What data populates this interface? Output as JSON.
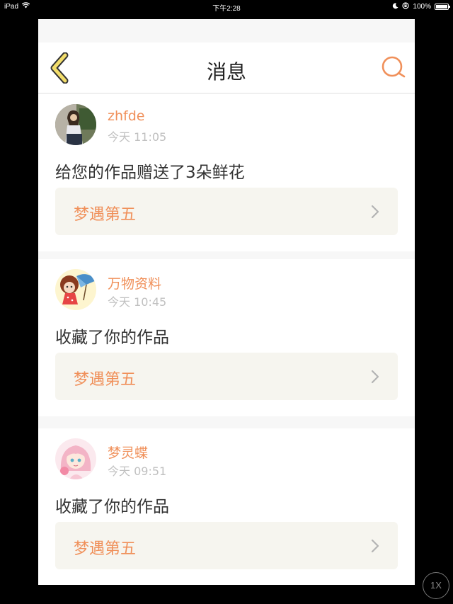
{
  "status_bar": {
    "device": "iPad",
    "time": "下午2:28",
    "battery": "100%",
    "battery_level": 1.0
  },
  "header": {
    "title": "消息",
    "back_icon": "chevron-left-icon",
    "search_icon": "search-icon"
  },
  "messages": [
    {
      "username": "zhfde",
      "time": "今天 11:05",
      "text": "给您的作品赠送了3朵鲜花",
      "work_title": "梦遇第五"
    },
    {
      "username": "万物资料",
      "time": "今天 10:45",
      "text": "收藏了你的作品",
      "work_title": "梦遇第五"
    },
    {
      "username": "梦灵蝶",
      "time": "今天 09:51",
      "text": "收藏了你的作品",
      "work_title": "梦遇第五"
    }
  ],
  "zoom": {
    "label": "1X"
  },
  "colors": {
    "accent": "#f0905a",
    "back_arrow_fill": "#f2dd6b",
    "card_link_bg": "#f6f5ef",
    "page_bg": "#f7f7f7"
  }
}
